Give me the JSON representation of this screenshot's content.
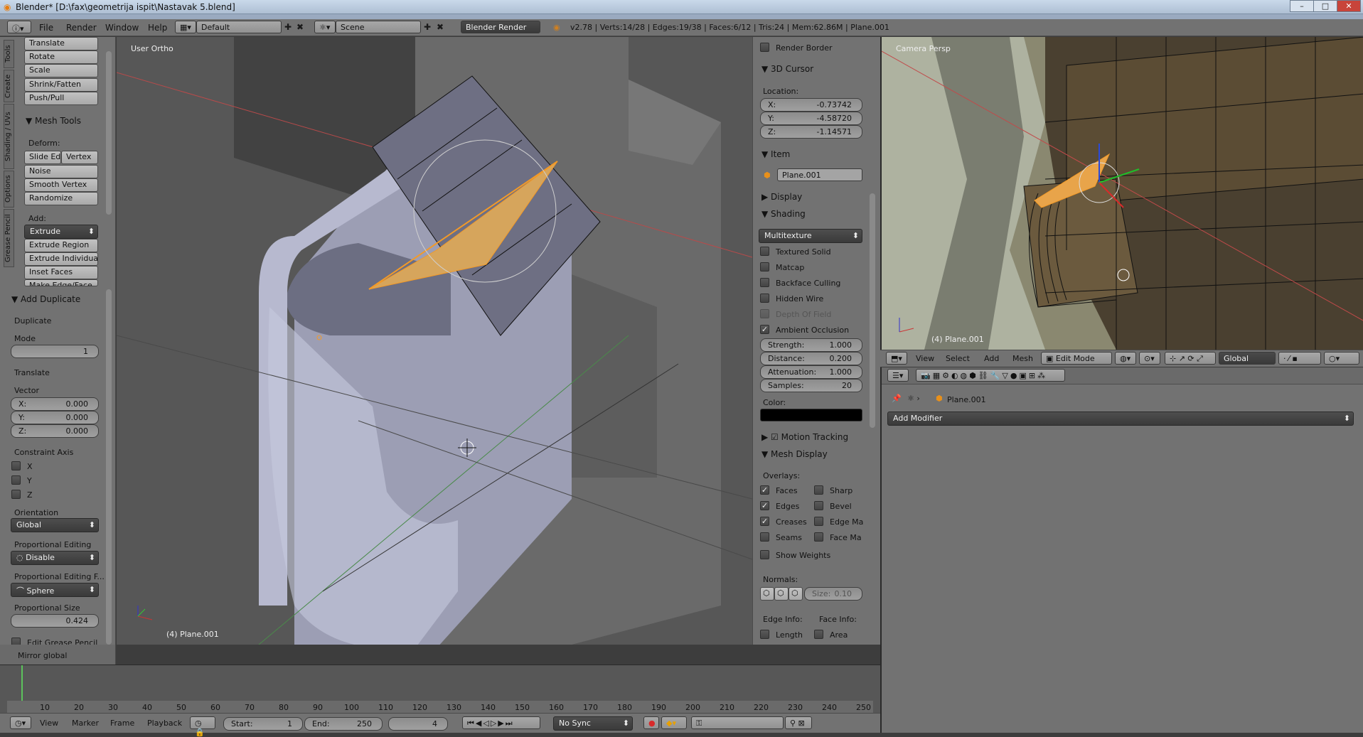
{
  "window": {
    "title": "Blender* [D:\\fax\\geometrija ispit\\Nastavak 5.blend]"
  },
  "menus": [
    "File",
    "Render",
    "Window",
    "Help"
  ],
  "layout": "Default",
  "scene": "Scene",
  "engine": "Blender Render",
  "stats": "v2.78 | Verts:14/28 | Edges:19/38 | Faces:6/12 | Tris:24 | Mem:62.86M | Plane.001",
  "tools": {
    "tabs": [
      "Tools",
      "Create",
      "Shading / UVs",
      "Options",
      "Grease Pencil"
    ],
    "transform": [
      "Translate",
      "Rotate",
      "Scale",
      "Shrink/Fatten",
      "Push/Pull"
    ],
    "mesh_tools": "Mesh Tools",
    "deform": "Deform:",
    "slide_ed": "Slide Ed",
    "vertex": "Vertex",
    "deform_items": [
      "Noise",
      "Smooth Vertex",
      "Randomize"
    ],
    "add": "Add:",
    "extrude": "Extrude",
    "add_items": [
      "Extrude Region",
      "Extrude Individual",
      "Inset Faces",
      "Make Edge/Face"
    ]
  },
  "operator": {
    "title": "Add Duplicate",
    "duplicate": "Duplicate",
    "mode": "Mode",
    "mode_val": "1",
    "translate": "Translate",
    "vector": "Vector",
    "vx": "0.000",
    "vy": "0.000",
    "vz": "0.000",
    "constraint": "Constraint Axis",
    "ax": "X",
    "ay": "Y",
    "az": "Z",
    "orientation": "Orientation",
    "orientation_val": "Global",
    "prop": "Proportional Editing",
    "prop_val": "Disable",
    "prop_f": "Proportional Editing F...",
    "prop_f_val": "Sphere",
    "prop_size": "Proportional Size",
    "prop_size_val": "0.424",
    "grease": "Edit Grease Pencil",
    "mirror": "Mirror global"
  },
  "viewport": {
    "label": "User Ortho",
    "object": "(4) Plane.001"
  },
  "props": {
    "render_border": "Render Border",
    "cursor": "3D Cursor",
    "location": "Location:",
    "cx": "-0.73742",
    "cy": "-4.58720",
    "cz": "-1.14571",
    "item": "Item",
    "item_name": "Plane.001",
    "display": "Display",
    "shading": "Shading",
    "shading_mode": "Multitexture",
    "shading_opts": [
      "Textured Solid",
      "Matcap",
      "Backface Culling",
      "Hidden Wire",
      "Depth Of Field",
      "Ambient Occlusion"
    ],
    "strength": "1.000",
    "distance": "0.200",
    "attenuation": "1.000",
    "samples": "20",
    "color": "Color:",
    "motion": "Motion Tracking",
    "mesh_display": "Mesh Display",
    "overlays": "Overlays:",
    "ov_left": [
      "Faces",
      "Edges",
      "Creases",
      "Seams"
    ],
    "ov_right": [
      "Sharp",
      "Bevel",
      "Edge Ma",
      "Face Ma"
    ],
    "show_weights": "Show Weights",
    "normals": "Normals:",
    "size": "Size:",
    "size_val": "0.10",
    "edge_info": "Edge Info:",
    "face_info": "Face Info:",
    "length": "Length",
    "area": "Area"
  },
  "camera": {
    "label": "Camera Persp",
    "object": "(4) Plane.001"
  },
  "cam_header": {
    "menus": [
      "View",
      "Select",
      "Add",
      "Mesh"
    ],
    "mode": "Edit Mode",
    "orient": "Global"
  },
  "modifiers": {
    "object": "Plane.001",
    "add": "Add Modifier"
  },
  "timeline": {
    "ticks": [
      "10",
      "20",
      "30",
      "40",
      "50",
      "60",
      "70",
      "80",
      "90",
      "100",
      "110",
      "120",
      "130",
      "140",
      "150",
      "160",
      "170",
      "180",
      "190",
      "200",
      "210",
      "220",
      "230",
      "240",
      "250"
    ],
    "menus": [
      "View",
      "Marker",
      "Frame",
      "Playback"
    ],
    "start": "Start:",
    "start_val": "1",
    "end": "End:",
    "end_val": "250",
    "frame": "4",
    "sync": "No Sync"
  }
}
